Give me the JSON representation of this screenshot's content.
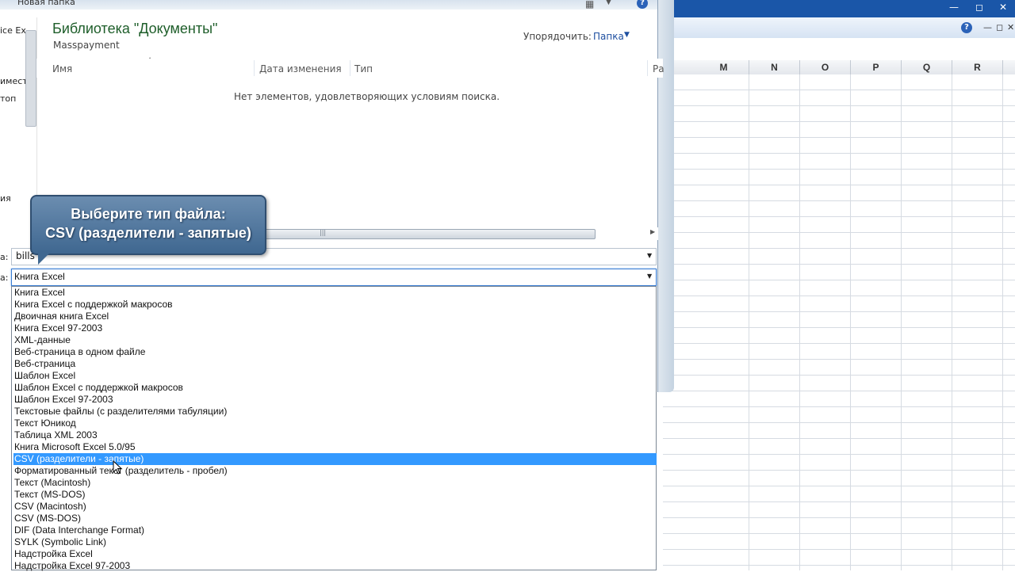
{
  "dialog": {
    "title": "Новая папка",
    "library_title": "Библиотека \"Документы\"",
    "library_subtitle": "Masspayment",
    "arrange_label": "Упорядочить:",
    "arrange_value": "Папка",
    "columns": [
      "Имя",
      "Дата изменения",
      "Тип",
      "Ра"
    ],
    "empty_message": "Нет элементов, удовлетворяющих условиям поиска.",
    "nav_fragments": [
      "ice Ex",
      "иместа",
      "топ",
      "ия"
    ],
    "filename_label": "а:",
    "filename_value": "bills",
    "filetype_label": "а:",
    "filetype_value": "Книга Excel",
    "filetypes": [
      "Книга Excel",
      "Книга Excel с поддержкой макросов",
      "Двоичная книга Excel",
      "Книга Excel 97-2003",
      "XML-данные",
      "Веб-страница в одном файле",
      "Веб-страница",
      "Шаблон Excel",
      "Шаблон Excel с поддержкой макросов",
      "Шаблон Excel 97-2003",
      "Текстовые файлы (с разделителями табуляции)",
      "Текст Юникод",
      "Таблица XML 2003",
      "Книга Microsoft Excel 5.0/95",
      "CSV (разделители - запятые)",
      "Форматированный текст (разделитель - пробел)",
      "Текст (Macintosh)",
      "Текст (MS-DOS)",
      "CSV (Macintosh)",
      "CSV (MS-DOS)",
      "DIF (Data Interchange Format)",
      "SYLK (Symbolic Link)",
      "Надстройка Excel",
      "Надстройка Excel 97-2003"
    ],
    "selected_filetype": "CSV (разделители - запятые)"
  },
  "callout": {
    "line1": "Выберите тип файла:",
    "line2": "CSV (разделители - запятые)"
  },
  "excel": {
    "columns": [
      "M",
      "N",
      "O",
      "P",
      "Q",
      "R"
    ],
    "help": "?"
  },
  "colors": {
    "selection": "#3399ff",
    "library_title": "#1e5e2a",
    "callout": "#4f7399",
    "excel_title": "#1a56a8"
  },
  "icons": [
    "view-icon",
    "help-icon",
    "dropdown-arrow-icon",
    "minimize-icon",
    "maximize-icon",
    "close-icon",
    "mouse-cursor-icon"
  ]
}
